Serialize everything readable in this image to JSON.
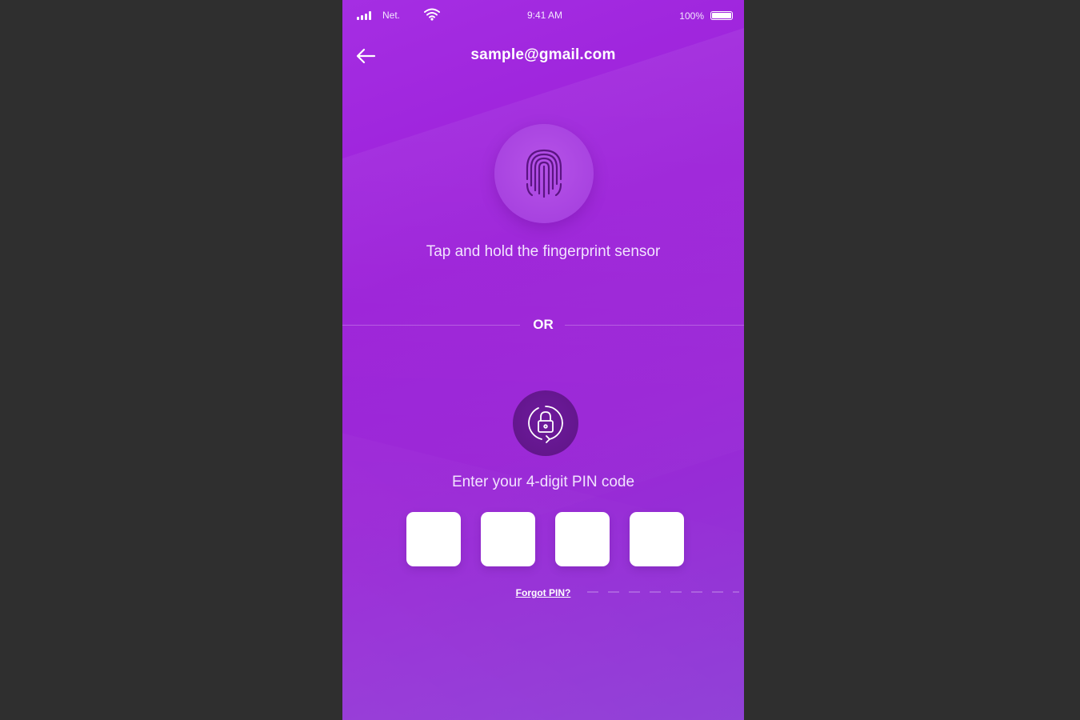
{
  "status_bar": {
    "carrier": "Net.",
    "time": "9:41 AM",
    "battery": "100%"
  },
  "header": {
    "back_icon": "arrow-left-icon",
    "email": "sample@gmail.com"
  },
  "fingerprint": {
    "icon": "fingerprint-icon",
    "instruction": "Tap and hold the fingerprint sensor"
  },
  "divider": {
    "label": "OR"
  },
  "pin": {
    "icon": "lock-rotate-icon",
    "instruction": "Enter your 4-digit PIN code",
    "digits": [
      "",
      "",
      "",
      ""
    ],
    "forgot_label": "Forgot PIN?"
  },
  "colors": {
    "background": "#9b1fd8",
    "accent_dark": "#5e1585",
    "accent_light": "#a843e0",
    "text": "#ffffff"
  }
}
